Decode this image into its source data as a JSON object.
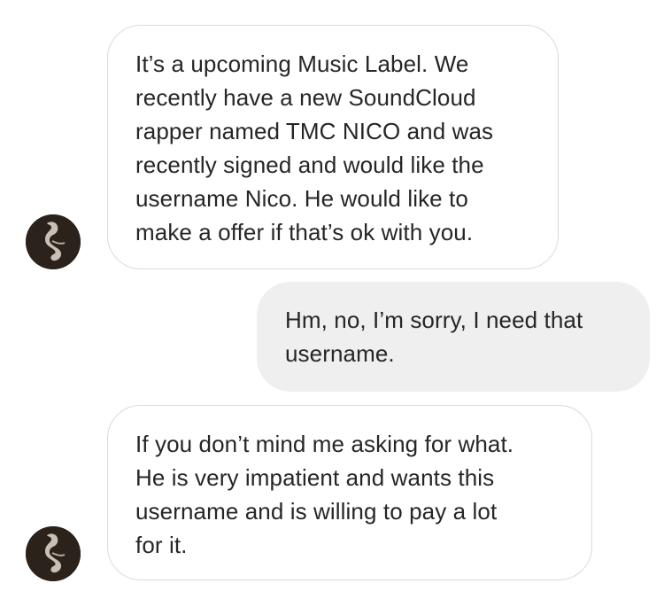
{
  "messages": [
    {
      "sender": "other",
      "lines": [
        "It’s a upcoming Music Label. We",
        "recently have a new SoundCloud",
        "rapper named TMC NICO and was",
        "recently signed and would like the",
        "username Nico. He would like to",
        "make a offer if that’s ok with you."
      ]
    },
    {
      "sender": "me",
      "lines": [
        "Hm, no, I’m sorry, I need that",
        "username."
      ]
    },
    {
      "sender": "other",
      "lines": [
        "If you don’t mind me asking for what.",
        "He is very impatient and wants this",
        "username and is willing to pay a lot",
        "for it."
      ]
    }
  ],
  "colors": {
    "incoming_bg": "#ffffff",
    "incoming_border": "#dbdbdb",
    "outgoing_bg": "#efefef",
    "text": "#262626",
    "avatar_bg": "#2b221b"
  },
  "icons": {
    "avatar": "profile-photo-avatar"
  }
}
